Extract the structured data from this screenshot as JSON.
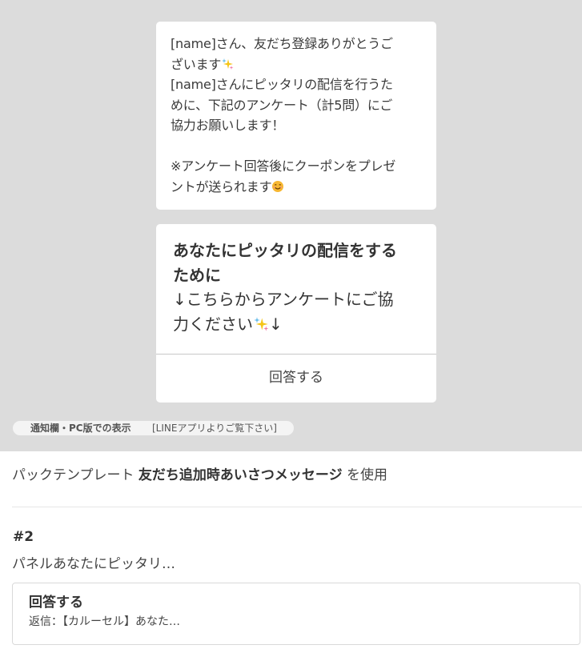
{
  "preview": {
    "greeting_lines": [
      "[name]さん、友だち登録ありがとうご",
      "ざいます",
      "[name]さんにピッタリの配信を行うた",
      "めに、下記のアンケート（計5問）にご",
      "協力お願いします！",
      "※アンケート回答後にクーポンをプレゼ",
      "ントが送られます"
    ],
    "card": {
      "title_lines": [
        "あなたにピッタリの配信をする",
        "ために"
      ],
      "text_lines": [
        "↓こちらからアンケートにご協",
        "力ください",
        "↓"
      ],
      "action_label": "回答する"
    },
    "notice": {
      "label": "通知欄・PC版での表示",
      "value": "[LINEアプリよりご覧下さい]"
    }
  },
  "template_info": {
    "prefix": "パックテンプレート",
    "name": "友だち追加時あいさつメッセージ",
    "suffix": "を使用"
  },
  "item": {
    "number": "#2",
    "summary": "パネルあなたにピッタリ…",
    "action": {
      "title": "回答する",
      "detail": "返信：【カルーセル】あなた…"
    }
  },
  "icons": [
    "sparkle-icon",
    "smile-icon"
  ],
  "colors": {
    "preview_background": "#dcdcdc",
    "sparkle_yellow": "#f5c518",
    "sparkle_pink": "#f06fa0",
    "sparkle_blue": "#58b7e8",
    "smile": "#f7b731"
  }
}
